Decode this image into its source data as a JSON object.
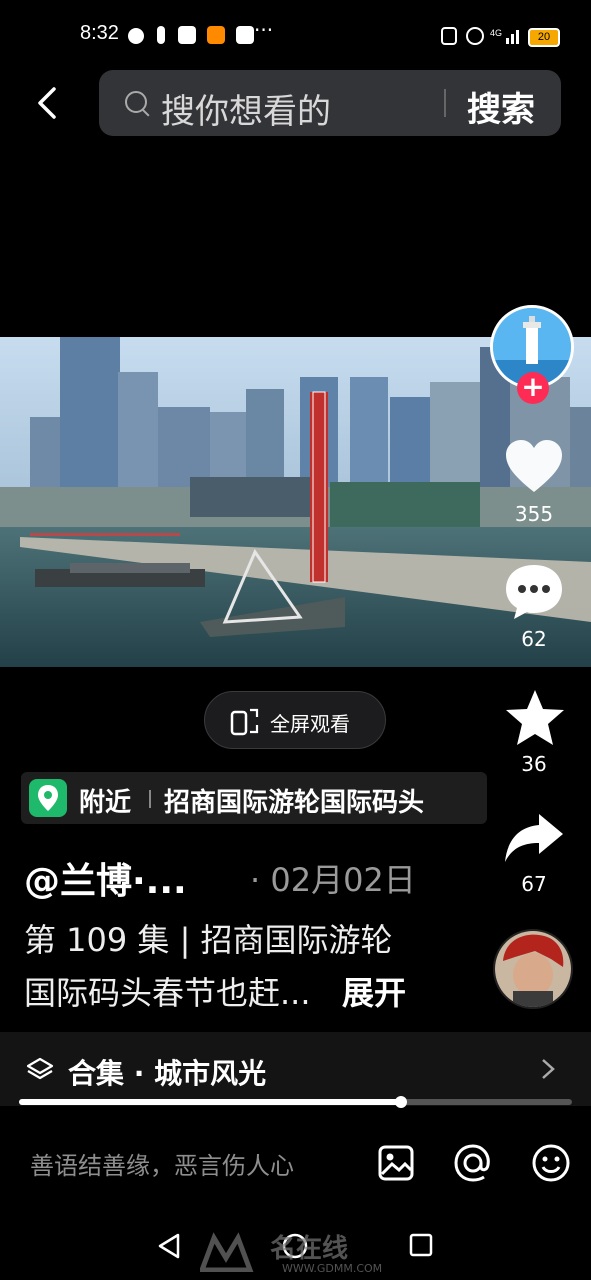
{
  "status": {
    "time": "8:32",
    "dots": "···",
    "battery": "20",
    "network": "4G"
  },
  "header": {
    "search_placeholder": "搜你想看的",
    "search_button": "搜索"
  },
  "video": {
    "fullscreen_label": "全屏观看"
  },
  "actions": {
    "likes": "355",
    "comments": "62",
    "favorites": "36",
    "shares": "67"
  },
  "location": {
    "label": "附近",
    "name": "招商国际游轮国际码头"
  },
  "post": {
    "author": "@兰博·...",
    "date": "· 02月02日",
    "caption_line1": "第 109 集 | 招商国际游轮",
    "caption_line2": "国际码头春节也赶...",
    "expand": "展开"
  },
  "collection": {
    "label": "合集 · 城市风光"
  },
  "playback": {
    "progress": 0.69
  },
  "comment_bar": {
    "placeholder": "善语结善缘，恶言伤人心"
  },
  "watermark": {
    "text": "名在线",
    "url": "WWW.GDMM.COM"
  },
  "colors": {
    "accent": "#fe2c55",
    "location_pin": "#1fb96b"
  }
}
